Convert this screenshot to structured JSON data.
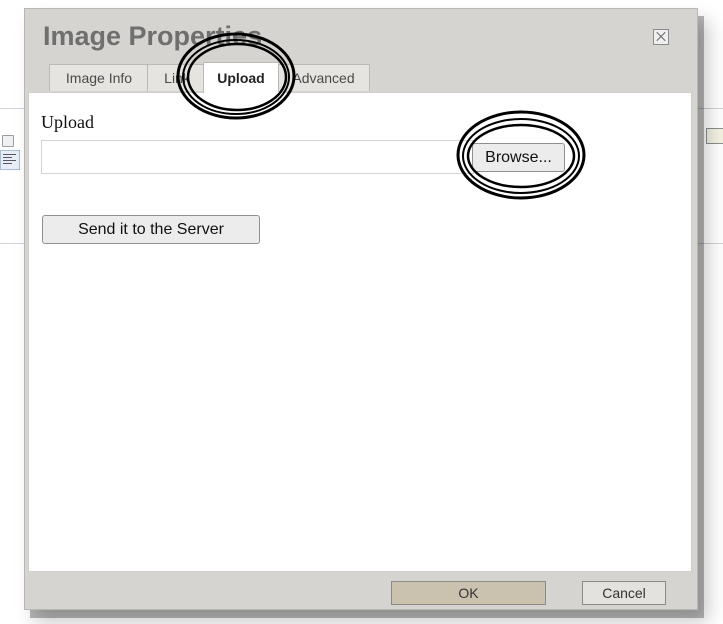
{
  "dialog": {
    "title": "Image Properties",
    "close_icon": "close-icon"
  },
  "tabs": [
    {
      "label": "Image Info",
      "active": false
    },
    {
      "label": "Link",
      "active": false
    },
    {
      "label": "Upload",
      "active": true
    },
    {
      "label": "Advanced",
      "active": false
    }
  ],
  "upload": {
    "label": "Upload",
    "file_value": "",
    "browse_label": "Browse..."
  },
  "send_button_label": "Send it to the Server",
  "footer": {
    "ok_label": "OK",
    "cancel_label": "Cancel"
  },
  "colors": {
    "dialog_bg": "#d6d4d1",
    "ok_bg": "#cac2ae",
    "title": "#6f6f6f"
  },
  "background_icons": [
    "print-icon",
    "align-left-icon",
    "image-icon"
  ]
}
